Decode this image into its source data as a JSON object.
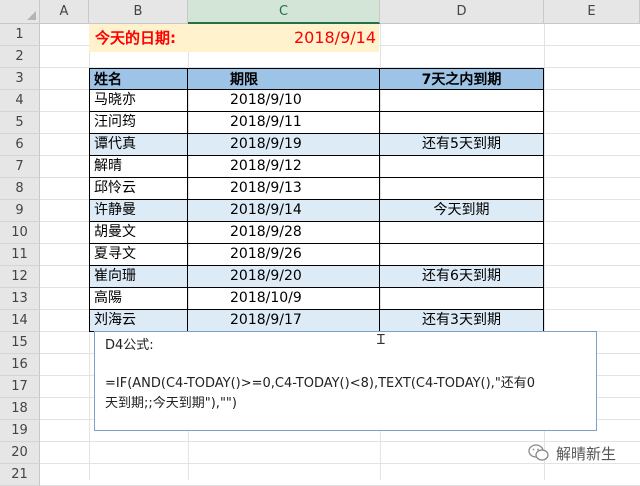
{
  "columns": [
    "A",
    "B",
    "C",
    "D",
    "E"
  ],
  "rows": [
    "1",
    "2",
    "3",
    "4",
    "5",
    "6",
    "7",
    "8",
    "9",
    "10",
    "11",
    "12",
    "13",
    "14",
    "15",
    "16",
    "17",
    "18",
    "19",
    "20",
    "21"
  ],
  "title": {
    "label": "今天的日期:",
    "date": "2018/9/14"
  },
  "table": {
    "headers": [
      "姓名",
      "期限",
      "7天之内到期"
    ],
    "rows": [
      {
        "name": "马晓亦",
        "date": "2018/9/10",
        "status": ""
      },
      {
        "name": "汪问筠",
        "date": "2018/9/11",
        "status": ""
      },
      {
        "name": "谭代真",
        "date": "2018/9/19",
        "status": "还有5天到期"
      },
      {
        "name": "解晴",
        "date": "2018/9/12",
        "status": ""
      },
      {
        "name": "邱怜云",
        "date": "2018/9/13",
        "status": ""
      },
      {
        "name": "许静曼",
        "date": "2018/9/14",
        "status": "今天到期"
      },
      {
        "name": "胡曼文",
        "date": "2018/9/28",
        "status": ""
      },
      {
        "name": "夏寻文",
        "date": "2018/9/26",
        "status": ""
      },
      {
        "name": "崔向珊",
        "date": "2018/9/20",
        "status": "还有6天到期"
      },
      {
        "name": "高陽",
        "date": "2018/10/9",
        "status": ""
      },
      {
        "name": "刘海云",
        "date": "2018/9/17",
        "status": "还有3天到期"
      }
    ]
  },
  "formula_note": {
    "heading": "D4公式:",
    "line1": "=IF(AND(C4-TODAY()>=0,C4-TODAY()<8),TEXT(C4-TODAY(),\"还有0",
    "line2": "天到期;;今天到期\"),\"\")"
  },
  "watermark": {
    "text": "解晴新生"
  },
  "colors": {
    "accent_red": "#ff0000",
    "header_blue": "#9dc3e6",
    "band_blue": "#ddebf7",
    "title_bg": "#fff2cc",
    "selected_col": "#217346"
  }
}
